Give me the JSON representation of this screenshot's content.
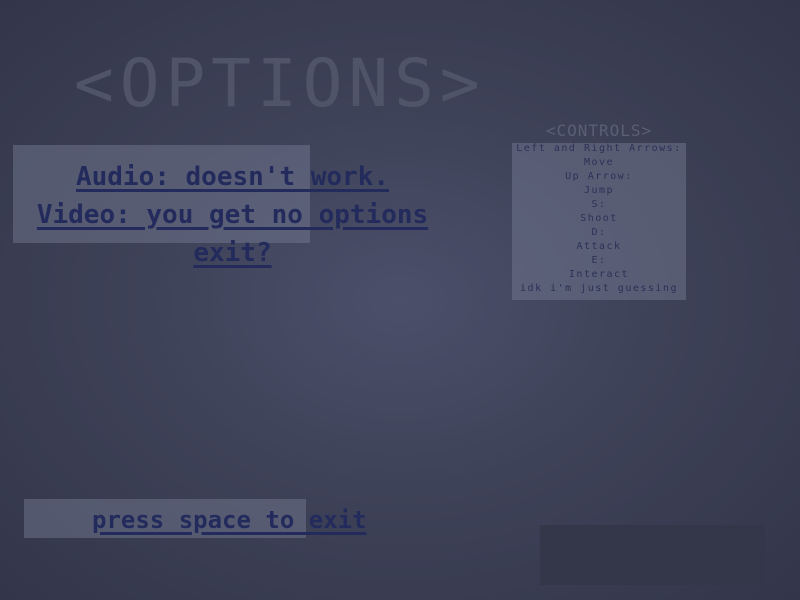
{
  "screen": {
    "title": "<OPTIONS>",
    "colors": {
      "background": "#44485f",
      "panel": "#6a6f86",
      "text": "#232a5c",
      "title": "#4f5469"
    }
  },
  "menu": {
    "items": [
      {
        "label": "Audio: doesn't work."
      },
      {
        "label": "Video: you get no options"
      },
      {
        "label": "exit?"
      }
    ]
  },
  "controls": {
    "title": "<CONTROLS>",
    "lines": [
      "Left and Right Arrows:",
      "Move",
      "Up Arrow:",
      "Jump",
      "S:",
      "Shoot",
      "D:",
      "Attack",
      "E:",
      "Interact",
      "idk i'm just guessing"
    ]
  },
  "footer": {
    "hint": "press space to exit"
  }
}
